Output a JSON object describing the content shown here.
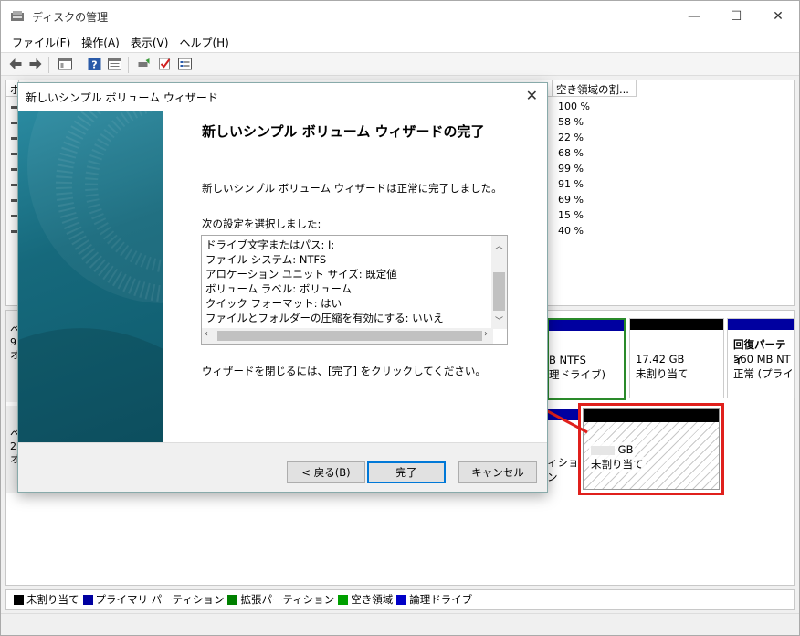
{
  "window": {
    "title": "ディスクの管理",
    "minimize": "—",
    "maximize": "☐",
    "close": "✕"
  },
  "menu": [
    "ファイル(F)",
    "操作(A)",
    "表示(V)",
    "ヘルプ(H)"
  ],
  "volume_list": {
    "headers": [
      "ボ",
      "空き領域の割..."
    ],
    "free_percent": [
      "100 %",
      "58 %",
      "22 %",
      "68 %",
      "99 %",
      "91 %",
      "69 %",
      "15 %",
      "40 %"
    ]
  },
  "disk_map": {
    "row1_left": [
      "ベ",
      "9",
      "オ"
    ],
    "row2_left": [
      "ベ",
      "2",
      "オ"
    ],
    "partitions": [
      {
        "line1": "B NTFS",
        "line2": "理ドライブ)"
      },
      {
        "line1": "17.42 GB",
        "line2": "未割り当て"
      },
      {
        "line1": "回復パーティ",
        "line2": "560 MB NT",
        "line3": "正常 (プライ"
      }
    ],
    "row2_partial": "ィション",
    "unallocated_new": {
      "line1": "GB",
      "line2": "未割り当て"
    }
  },
  "legend": [
    "未割り当て",
    "プライマリ パーティション",
    "拡張パーティション",
    "空き領域",
    "論理ドライブ"
  ],
  "colors": {
    "unallocated": "#000000",
    "primary": "#0000a0",
    "extended": "#008000",
    "free": "#00a000",
    "logical": "#0000c8",
    "highlight": "#e0201c"
  },
  "wizard": {
    "title": "新しいシンプル ボリューム ウィザード",
    "heading": "新しいシンプル ボリューム ウィザードの完了",
    "message": "新しいシンプル ボリューム ウィザードは正常に完了しました。",
    "settings_label": "次の設定を選択しました:",
    "settings": [
      "ドライブ文字またはパス: I:",
      "ファイル システム: NTFS",
      "アロケーション ユニット サイズ: 既定値",
      "ボリューム ラベル: ボリューム",
      "クイック フォーマット: はい",
      "ファイルとフォルダーの圧縮を有効にする: いいえ"
    ],
    "hint": "ウィザードを閉じるには、[完了] をクリックしてください。",
    "back": "< 戻る(B)",
    "finish": "完了",
    "cancel": "キャンセル"
  }
}
